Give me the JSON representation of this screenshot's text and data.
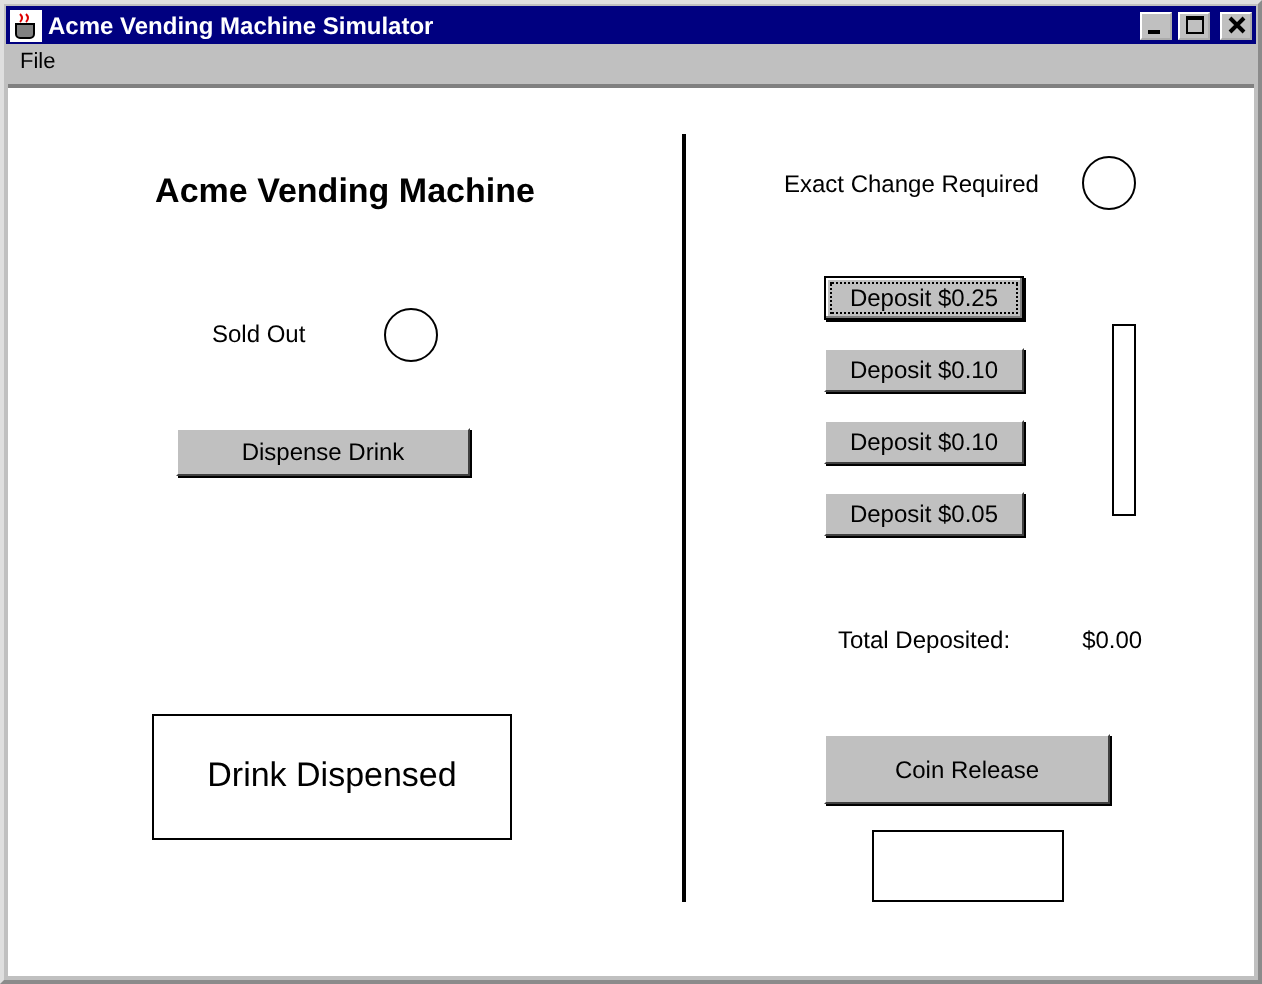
{
  "window": {
    "title": "Acme Vending Machine Simulator"
  },
  "menu": [
    "File"
  ],
  "machine": {
    "title": "Acme Vending Machine",
    "sold_out": {
      "label": "Sold Out",
      "lit": false
    },
    "dispense_button": "Dispense Drink",
    "dispensed_display": "Drink Dispensed"
  },
  "payment": {
    "exact_change": {
      "label": "Exact Change Required",
      "lit": false
    },
    "deposit_buttons": [
      {
        "label": "Deposit $0.25",
        "focused": true
      },
      {
        "label": "Deposit $0.10",
        "focused": false
      },
      {
        "label": "Deposit $0.10",
        "focused": false
      },
      {
        "label": "Deposit $0.05",
        "focused": false
      }
    ],
    "total_label": "Total Deposited:",
    "total": "$0.00",
    "coin_release": "Coin Release"
  }
}
